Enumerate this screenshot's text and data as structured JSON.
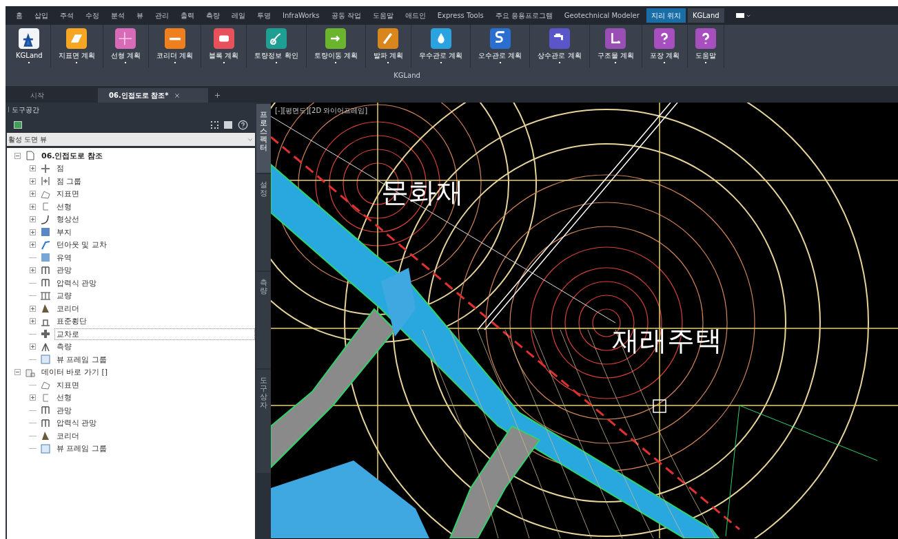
{
  "menu_tabs": [
    {
      "label": "홈",
      "kind": "normal",
      "selected": false
    },
    {
      "label": "삽입",
      "kind": "normal",
      "selected": false
    },
    {
      "label": "주석",
      "kind": "normal",
      "selected": false
    },
    {
      "label": "수정",
      "kind": "normal",
      "selected": false
    },
    {
      "label": "분석",
      "kind": "normal",
      "selected": false
    },
    {
      "label": "뷰",
      "kind": "normal",
      "selected": false
    },
    {
      "label": "관리",
      "kind": "normal",
      "selected": false
    },
    {
      "label": "출력",
      "kind": "normal",
      "selected": false
    },
    {
      "label": "측량",
      "kind": "normal",
      "selected": false
    },
    {
      "label": "레일",
      "kind": "normal",
      "selected": false
    },
    {
      "label": "투명",
      "kind": "normal",
      "selected": false
    },
    {
      "label": "InfraWorks",
      "kind": "normal",
      "selected": false
    },
    {
      "label": "공동 작업",
      "kind": "normal",
      "selected": false
    },
    {
      "label": "도움말",
      "kind": "normal",
      "selected": false
    },
    {
      "label": "애드인",
      "kind": "normal",
      "selected": false
    },
    {
      "label": "Express Tools",
      "kind": "normal",
      "selected": false
    },
    {
      "label": "주요 응용프로그램",
      "kind": "normal",
      "selected": false
    },
    {
      "label": "Geotechnical Modeler",
      "kind": "normal",
      "selected": false
    },
    {
      "label": "지리 위치",
      "kind": "contextual",
      "selected": false
    },
    {
      "label": "KGLand",
      "kind": "normal",
      "selected": true
    }
  ],
  "ribbon": {
    "group_label": "KGLand",
    "buttons": [
      {
        "label": "KGLand",
        "has_menu": true
      },
      {
        "label": "지표면 계획",
        "has_menu": true
      },
      {
        "label": "선형 계획",
        "has_menu": true
      },
      {
        "label": "코리더 계획",
        "has_menu": true
      },
      {
        "label": "블록 계획",
        "has_menu": true
      },
      {
        "label": "토량정보 확인",
        "has_menu": true
      },
      {
        "label": "토량이동 계획",
        "has_menu": true
      },
      {
        "label": "발파 계획",
        "has_menu": true
      },
      {
        "label": "우수관로 계획",
        "has_menu": true
      },
      {
        "label": "오수관로 계획",
        "has_menu": true
      },
      {
        "label": "상수관로 계획",
        "has_menu": true
      },
      {
        "label": "구조물 계획",
        "has_menu": true
      },
      {
        "label": "포장 계획",
        "has_menu": true
      },
      {
        "label": "도움말",
        "has_menu": true
      }
    ]
  },
  "doc_tabs": [
    {
      "label": "시작",
      "selected": false,
      "closable": false
    },
    {
      "label": "06.인접도로 참조*",
      "selected": true,
      "closable": true
    }
  ],
  "toolspace": {
    "title": "도구공간",
    "view_dropdown": "활성 도면 뷰",
    "tree": [
      {
        "label": "06.인접도로 참조",
        "kind": "drawing",
        "expandable": true,
        "expanded": true,
        "selected": false,
        "children": [
          {
            "label": "점",
            "kind": "point",
            "expandable": true,
            "expanded": false,
            "selected": false
          },
          {
            "label": "점 그룹",
            "kind": "pointgroup",
            "expandable": true,
            "expanded": false,
            "selected": false
          },
          {
            "label": "지표면",
            "kind": "surface",
            "expandable": true,
            "expanded": false,
            "selected": false
          },
          {
            "label": "선형",
            "kind": "alignment",
            "expandable": true,
            "expanded": false,
            "selected": false
          },
          {
            "label": "형상선",
            "kind": "featureline",
            "expandable": true,
            "expanded": false,
            "selected": false
          },
          {
            "label": "부지",
            "kind": "site",
            "expandable": true,
            "expanded": false,
            "selected": false
          },
          {
            "label": "턴아웃 및 교차",
            "kind": "turnout",
            "expandable": true,
            "expanded": false,
            "selected": false
          },
          {
            "label": "유역",
            "kind": "catchment",
            "expandable": false,
            "selected": false
          },
          {
            "label": "관망",
            "kind": "network",
            "expandable": true,
            "expanded": false,
            "selected": false
          },
          {
            "label": "압력식 관망",
            "kind": "network",
            "expandable": false,
            "selected": false
          },
          {
            "label": "교량",
            "kind": "bridge",
            "expandable": false,
            "selected": false
          },
          {
            "label": "코리더",
            "kind": "corridor",
            "expandable": true,
            "expanded": false,
            "selected": false
          },
          {
            "label": "표준횡단",
            "kind": "assembly",
            "expandable": true,
            "expanded": false,
            "selected": false
          },
          {
            "label": "교차로",
            "kind": "intersection",
            "expandable": false,
            "selected": true
          },
          {
            "label": "측량",
            "kind": "survey",
            "expandable": true,
            "expanded": false,
            "selected": false
          },
          {
            "label": "뷰 프레임 그룹",
            "kind": "viewframe",
            "expandable": false,
            "selected": false
          }
        ]
      },
      {
        "label": "데이터 바로 가기 []",
        "kind": "shortcut",
        "expandable": true,
        "expanded": true,
        "selected": false,
        "children": [
          {
            "label": "지표면",
            "kind": "surface",
            "expandable": false,
            "selected": false
          },
          {
            "label": "선형",
            "kind": "alignment",
            "expandable": true,
            "expanded": false,
            "selected": false
          },
          {
            "label": "관망",
            "kind": "network",
            "expandable": false,
            "selected": false
          },
          {
            "label": "압력식 관망",
            "kind": "network",
            "expandable": false,
            "selected": false
          },
          {
            "label": "코리더",
            "kind": "corridor",
            "expandable": false,
            "selected": false
          },
          {
            "label": "뷰 프레임 그룹",
            "kind": "viewframe",
            "expandable": false,
            "selected": false
          }
        ]
      }
    ],
    "side_tabs": [
      {
        "label": "프로스펙터",
        "selected": true
      },
      {
        "label": "설정",
        "selected": false
      },
      {
        "label": "측량",
        "selected": false
      },
      {
        "label": "도구 상자",
        "selected": false
      }
    ]
  },
  "viewport": {
    "label": "[-][평면도][2D 와이어프레임]",
    "annotations": [
      "문화재",
      "재래주택"
    ]
  }
}
